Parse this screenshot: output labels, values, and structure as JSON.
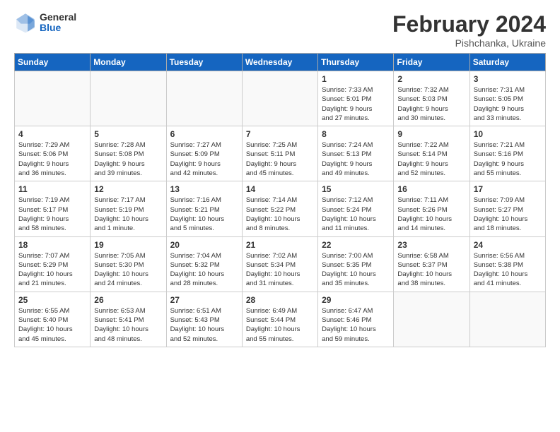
{
  "header": {
    "logo_general": "General",
    "logo_blue": "Blue",
    "month_title": "February 2024",
    "subtitle": "Pishchanka, Ukraine"
  },
  "weekdays": [
    "Sunday",
    "Monday",
    "Tuesday",
    "Wednesday",
    "Thursday",
    "Friday",
    "Saturday"
  ],
  "weeks": [
    [
      {
        "day": "",
        "detail": ""
      },
      {
        "day": "",
        "detail": ""
      },
      {
        "day": "",
        "detail": ""
      },
      {
        "day": "",
        "detail": ""
      },
      {
        "day": "1",
        "detail": "Sunrise: 7:33 AM\nSunset: 5:01 PM\nDaylight: 9 hours\nand 27 minutes."
      },
      {
        "day": "2",
        "detail": "Sunrise: 7:32 AM\nSunset: 5:03 PM\nDaylight: 9 hours\nand 30 minutes."
      },
      {
        "day": "3",
        "detail": "Sunrise: 7:31 AM\nSunset: 5:05 PM\nDaylight: 9 hours\nand 33 minutes."
      }
    ],
    [
      {
        "day": "4",
        "detail": "Sunrise: 7:29 AM\nSunset: 5:06 PM\nDaylight: 9 hours\nand 36 minutes."
      },
      {
        "day": "5",
        "detail": "Sunrise: 7:28 AM\nSunset: 5:08 PM\nDaylight: 9 hours\nand 39 minutes."
      },
      {
        "day": "6",
        "detail": "Sunrise: 7:27 AM\nSunset: 5:09 PM\nDaylight: 9 hours\nand 42 minutes."
      },
      {
        "day": "7",
        "detail": "Sunrise: 7:25 AM\nSunset: 5:11 PM\nDaylight: 9 hours\nand 45 minutes."
      },
      {
        "day": "8",
        "detail": "Sunrise: 7:24 AM\nSunset: 5:13 PM\nDaylight: 9 hours\nand 49 minutes."
      },
      {
        "day": "9",
        "detail": "Sunrise: 7:22 AM\nSunset: 5:14 PM\nDaylight: 9 hours\nand 52 minutes."
      },
      {
        "day": "10",
        "detail": "Sunrise: 7:21 AM\nSunset: 5:16 PM\nDaylight: 9 hours\nand 55 minutes."
      }
    ],
    [
      {
        "day": "11",
        "detail": "Sunrise: 7:19 AM\nSunset: 5:17 PM\nDaylight: 9 hours\nand 58 minutes."
      },
      {
        "day": "12",
        "detail": "Sunrise: 7:17 AM\nSunset: 5:19 PM\nDaylight: 10 hours\nand 1 minute."
      },
      {
        "day": "13",
        "detail": "Sunrise: 7:16 AM\nSunset: 5:21 PM\nDaylight: 10 hours\nand 5 minutes."
      },
      {
        "day": "14",
        "detail": "Sunrise: 7:14 AM\nSunset: 5:22 PM\nDaylight: 10 hours\nand 8 minutes."
      },
      {
        "day": "15",
        "detail": "Sunrise: 7:12 AM\nSunset: 5:24 PM\nDaylight: 10 hours\nand 11 minutes."
      },
      {
        "day": "16",
        "detail": "Sunrise: 7:11 AM\nSunset: 5:26 PM\nDaylight: 10 hours\nand 14 minutes."
      },
      {
        "day": "17",
        "detail": "Sunrise: 7:09 AM\nSunset: 5:27 PM\nDaylight: 10 hours\nand 18 minutes."
      }
    ],
    [
      {
        "day": "18",
        "detail": "Sunrise: 7:07 AM\nSunset: 5:29 PM\nDaylight: 10 hours\nand 21 minutes."
      },
      {
        "day": "19",
        "detail": "Sunrise: 7:05 AM\nSunset: 5:30 PM\nDaylight: 10 hours\nand 24 minutes."
      },
      {
        "day": "20",
        "detail": "Sunrise: 7:04 AM\nSunset: 5:32 PM\nDaylight: 10 hours\nand 28 minutes."
      },
      {
        "day": "21",
        "detail": "Sunrise: 7:02 AM\nSunset: 5:34 PM\nDaylight: 10 hours\nand 31 minutes."
      },
      {
        "day": "22",
        "detail": "Sunrise: 7:00 AM\nSunset: 5:35 PM\nDaylight: 10 hours\nand 35 minutes."
      },
      {
        "day": "23",
        "detail": "Sunrise: 6:58 AM\nSunset: 5:37 PM\nDaylight: 10 hours\nand 38 minutes."
      },
      {
        "day": "24",
        "detail": "Sunrise: 6:56 AM\nSunset: 5:38 PM\nDaylight: 10 hours\nand 41 minutes."
      }
    ],
    [
      {
        "day": "25",
        "detail": "Sunrise: 6:55 AM\nSunset: 5:40 PM\nDaylight: 10 hours\nand 45 minutes."
      },
      {
        "day": "26",
        "detail": "Sunrise: 6:53 AM\nSunset: 5:41 PM\nDaylight: 10 hours\nand 48 minutes."
      },
      {
        "day": "27",
        "detail": "Sunrise: 6:51 AM\nSunset: 5:43 PM\nDaylight: 10 hours\nand 52 minutes."
      },
      {
        "day": "28",
        "detail": "Sunrise: 6:49 AM\nSunset: 5:44 PM\nDaylight: 10 hours\nand 55 minutes."
      },
      {
        "day": "29",
        "detail": "Sunrise: 6:47 AM\nSunset: 5:46 PM\nDaylight: 10 hours\nand 59 minutes."
      },
      {
        "day": "",
        "detail": ""
      },
      {
        "day": "",
        "detail": ""
      }
    ]
  ]
}
